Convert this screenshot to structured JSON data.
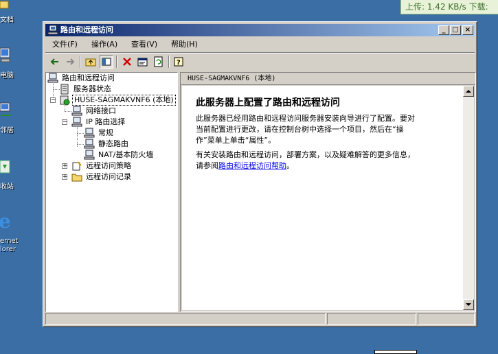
{
  "desktop": {
    "icons": [
      {
        "label": "文档"
      },
      {
        "label": "电脑"
      },
      {
        "label": "邻居"
      },
      {
        "label": "收站"
      },
      {
        "label": "ernet"
      },
      {
        "label": "lorer"
      }
    ]
  },
  "netspeed": {
    "text": "上传: 1.42 KB/s    下载: "
  },
  "window": {
    "title": "路由和远程访问",
    "controls": {
      "minimize": "_",
      "maximize": "□",
      "close": "×"
    }
  },
  "menu": {
    "items": [
      {
        "label": "文件(F)"
      },
      {
        "label": "操作(A)"
      },
      {
        "label": "查看(V)"
      },
      {
        "label": "帮助(H)"
      }
    ]
  },
  "tree": {
    "root": "路由和远程访问",
    "server_status": "服务器状态",
    "server": "HUSE-SAGMAKVNF6 (本地)",
    "net_if": "网络接口",
    "ip_routing": "IP 路由选择",
    "general": "常规",
    "static_routes": "静态路由",
    "nat": "NAT/基本防火墙",
    "remote_policies": "远程访问策略",
    "remote_logging": "远程访问记录"
  },
  "right": {
    "header": "HUSE-SAGMAKVNF6 (本地)",
    "title": "此服务器上配置了路由和远程访问",
    "para1_line1": "此服务器已经用路由和远程访问服务器安装向导进行了配置。要对",
    "para1_line2": "当前配置进行更改，请在控制台树中选择一个项目，然后在“操",
    "para1_line3": "作”菜单上单击“属性”。",
    "para2_line1": "有关安装路由和远程访问，部署方案，以及疑难解答的更多信息，",
    "para2_prefix": "请参阅",
    "para2_link": "路由和远程访问帮助",
    "para2_suffix": "。"
  },
  "colors": {
    "desktop": "#3a6ea5",
    "title_start": "#0a246a",
    "title_end": "#a6caf0",
    "link": "#0000ee"
  }
}
